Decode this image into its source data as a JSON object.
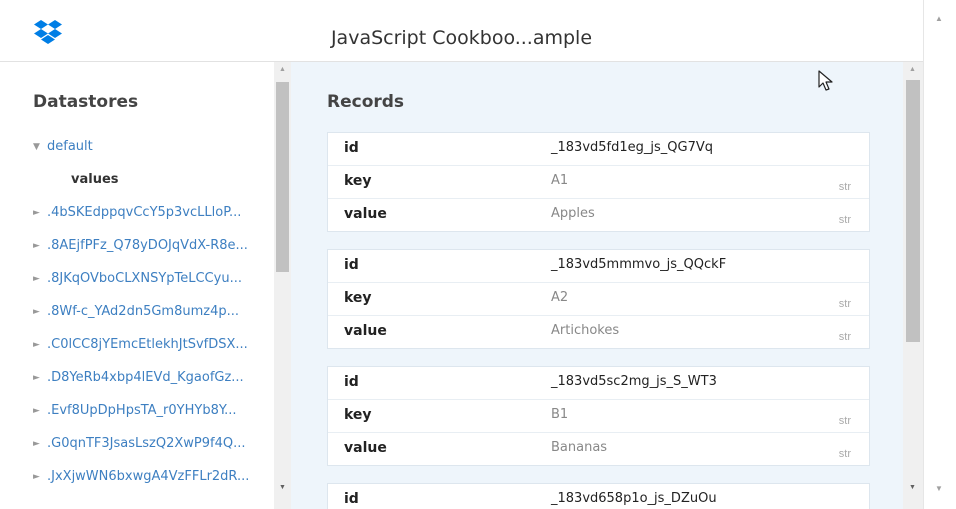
{
  "app": {
    "title": "JavaScript Cookboo...ample",
    "brand_color": "#007ee5"
  },
  "sidebar": {
    "heading": "Datastores",
    "items": [
      {
        "label": "default",
        "expanded": true
      },
      {
        "label": "values",
        "child": true
      },
      {
        "label": ".4bSKEdppqvCcY5p3vcLLloP..."
      },
      {
        "label": ".8AEjfPFz_Q78yDOJqVdX-R8e..."
      },
      {
        "label": ".8JKqOVboCLXNSYpTeLCCyu..."
      },
      {
        "label": ".8Wf-c_YAd2dn5Gm8umz4p..."
      },
      {
        "label": ".C0lCC8jYEmcEtlekhJtSvfDSX..."
      },
      {
        "label": ".D8YeRb4xbp4lEVd_KgaofGz..."
      },
      {
        "label": ".Evf8UpDpHpsTA_r0YHYb8Y..."
      },
      {
        "label": ".G0qnTF3JsasLszQ2XwP9f4Q..."
      },
      {
        "label": ".JxXjwWN6bxwgA4VzFFLr2dR..."
      }
    ],
    "glyphs": {
      "expanded": "▼",
      "collapsed": "►"
    }
  },
  "records_panel": {
    "heading": "Records",
    "records": [
      {
        "id_label": "id",
        "id": "_183vd5fd1eg_js_QG7Vq",
        "fields": [
          {
            "name": "key",
            "value": "A1",
            "type": "str"
          },
          {
            "name": "value",
            "value": "Apples",
            "type": "str"
          }
        ]
      },
      {
        "id_label": "id",
        "id": "_183vd5mmmvo_js_QQckF",
        "fields": [
          {
            "name": "key",
            "value": "A2",
            "type": "str"
          },
          {
            "name": "value",
            "value": "Artichokes",
            "type": "str"
          }
        ]
      },
      {
        "id_label": "id",
        "id": "_183vd5sc2mg_js_S_WT3",
        "fields": [
          {
            "name": "key",
            "value": "B1",
            "type": "str"
          },
          {
            "name": "value",
            "value": "Bananas",
            "type": "str"
          }
        ]
      },
      {
        "id_label": "id",
        "id": "_183vd658p1o_js_DZuOu",
        "fields": []
      }
    ]
  },
  "icons": {
    "logo": "dropbox-logo-icon",
    "scroll_up": "▲",
    "scroll_down": "▼",
    "cursor": "mouse-pointer-icon"
  }
}
